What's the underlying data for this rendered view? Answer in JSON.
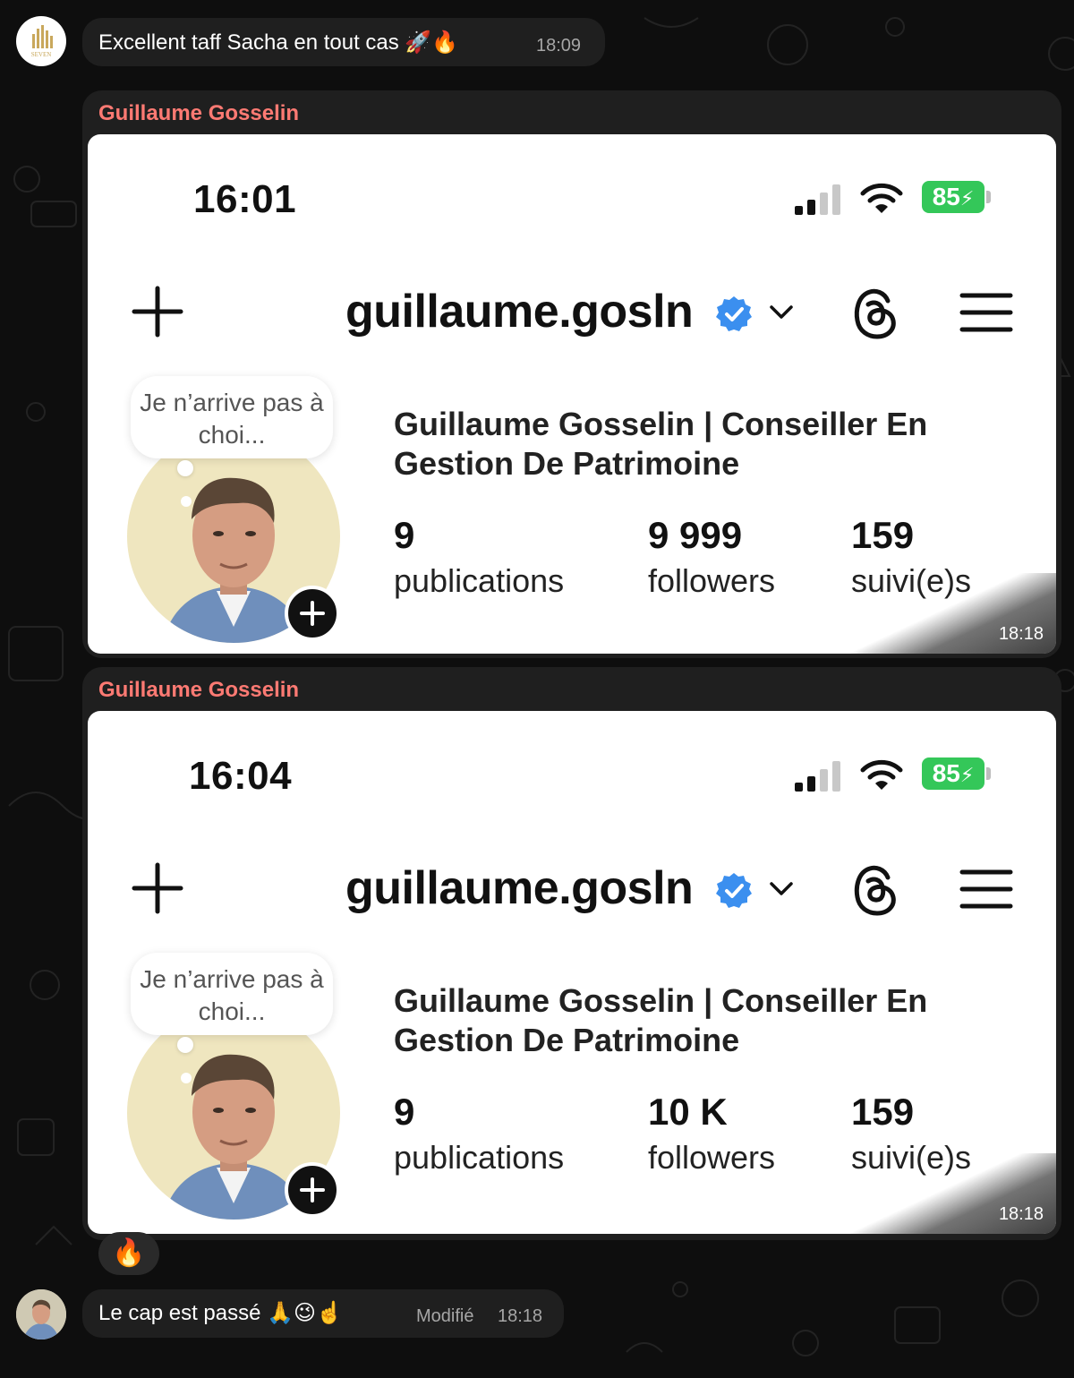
{
  "messages": {
    "first": {
      "text": "Excellent taff Sacha en tout cas 🚀🔥",
      "time": "18:09",
      "avatar_label": "SEVEN"
    },
    "shot1": {
      "sender": "Guillaume Gosselin",
      "stamp": "18:18",
      "phone_time": "16:01",
      "battery": "85",
      "username": "guillaume.gosln",
      "note": "Je n’arrive pas à choi...",
      "full_name": "Guillaume Gosselin | Conseiller En Gestion De Patrimoine",
      "publications_count": "9",
      "publications_label": "publications",
      "followers_count": "9 999",
      "followers_label": "followers",
      "following_count": "159",
      "following_label": "suivi(e)s"
    },
    "shot2": {
      "sender": "Guillaume Gosselin",
      "stamp": "18:18",
      "phone_time": "16:04",
      "battery": "85",
      "username": "guillaume.gosln",
      "note": "Je n’arrive pas à choi...",
      "full_name": "Guillaume Gosselin | Conseiller En Gestion De Patrimoine",
      "publications_count": "9",
      "publications_label": "publications",
      "followers_count": "10 K",
      "followers_label": "followers",
      "following_count": "159",
      "following_label": "suivi(e)s"
    },
    "reaction": "🔥",
    "last": {
      "text": "Le cap est passé 🙏😉☝️",
      "edited": "Modifié",
      "time": "18:18"
    }
  },
  "colors": {
    "background": "#0e0e0e",
    "bubble": "#1f1f1f",
    "sender_name": "#ff7a73",
    "verified": "#3b8fef",
    "battery": "#34c759"
  },
  "icons": [
    "plus-icon",
    "verified-badge-icon",
    "chevron-down-icon",
    "threads-icon",
    "menu-icon",
    "signal-icon",
    "wifi-icon",
    "battery-icon"
  ]
}
